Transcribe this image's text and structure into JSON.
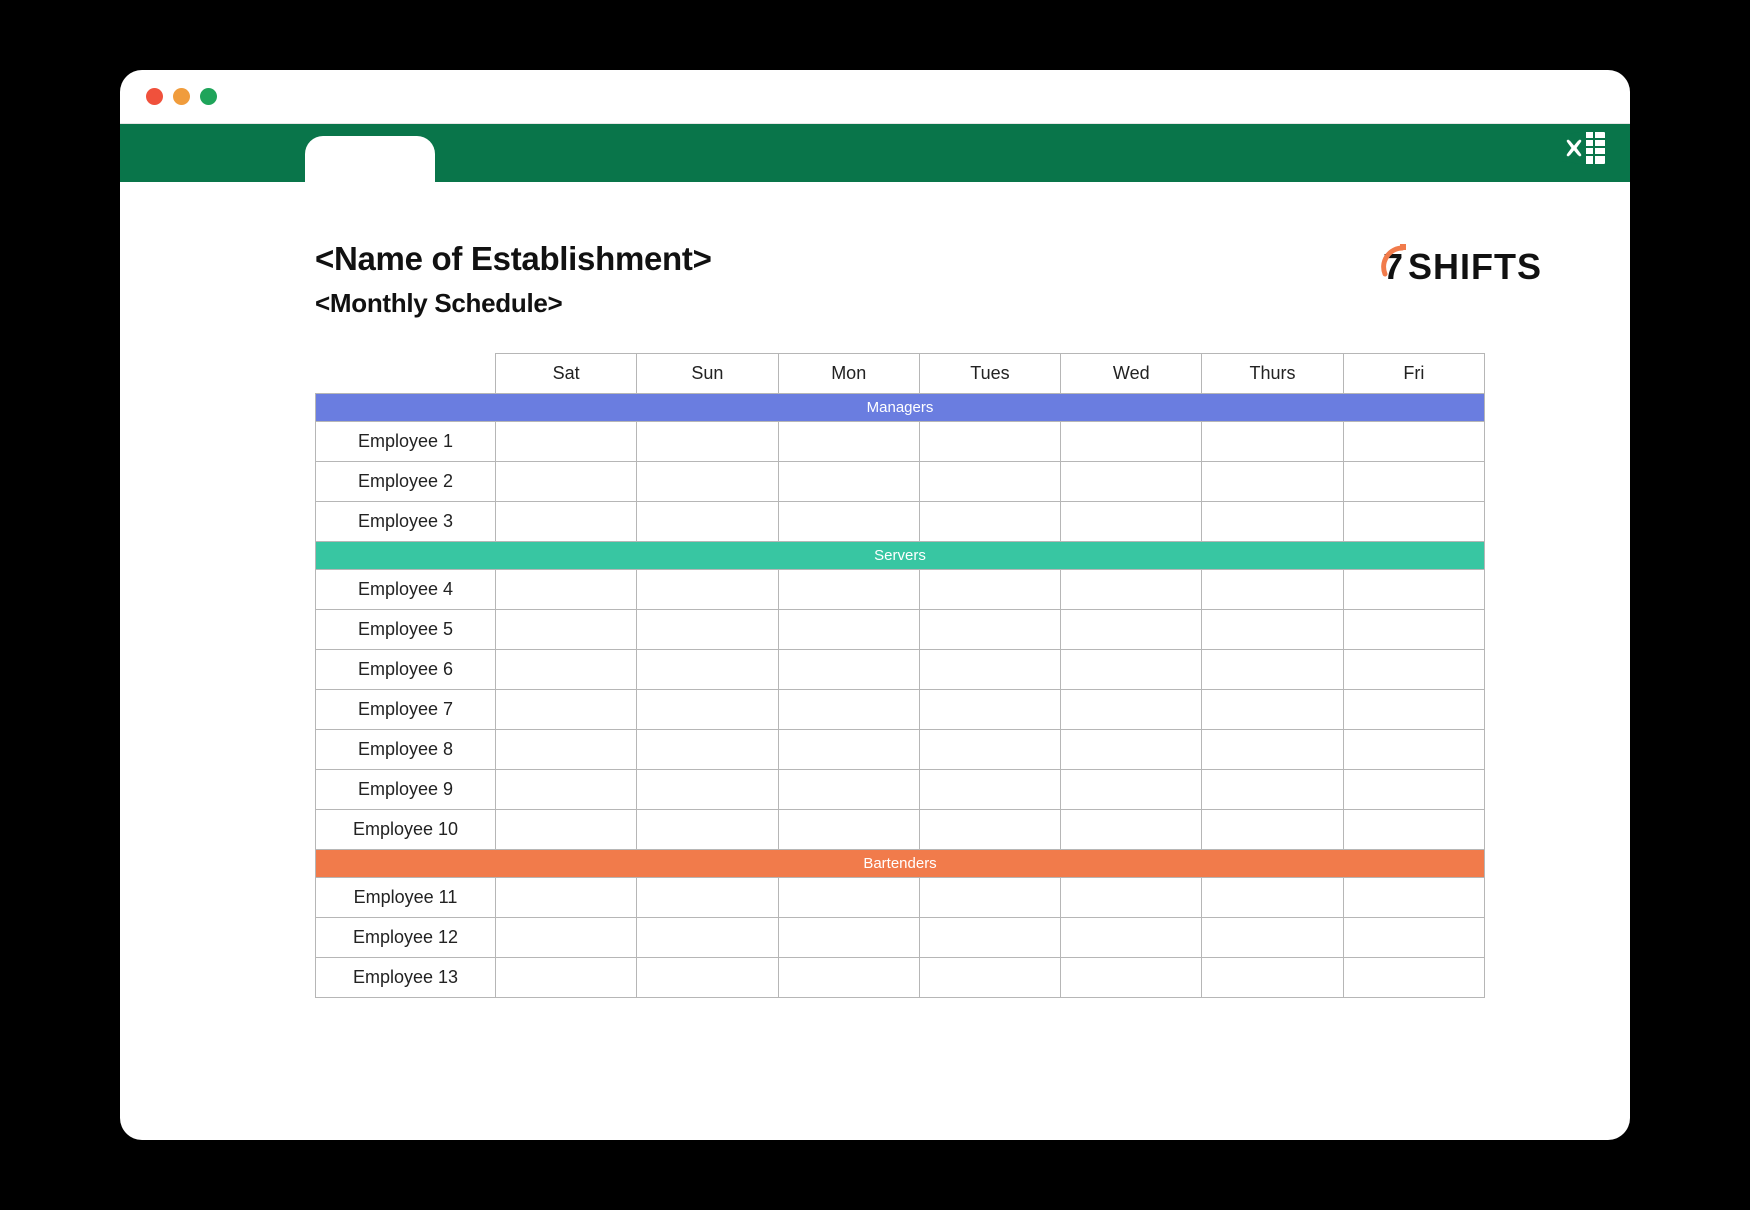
{
  "titlebar": {
    "dots": [
      "red",
      "yellow",
      "green"
    ]
  },
  "header": {
    "title": "<Name of Establishment>",
    "subtitle": "<Monthly Schedule>"
  },
  "brand": {
    "digit": "7",
    "word": "SHIFTS",
    "accent": "#f17b4b"
  },
  "days": [
    "Sat",
    "Sun",
    "Mon",
    "Tues",
    "Wed",
    "Thurs",
    "Fri"
  ],
  "sections": [
    {
      "name": "Managers",
      "class": "managers",
      "employees": [
        "Employee 1",
        "Employee 2",
        "Employee 3"
      ]
    },
    {
      "name": "Servers",
      "class": "servers",
      "employees": [
        "Employee 4",
        "Employee 5",
        "Employee 6",
        "Employee 7",
        "Employee 8",
        "Employee 9",
        "Employee 10"
      ]
    },
    {
      "name": "Bartenders",
      "class": "bartenders",
      "employees": [
        "Employee 11",
        "Employee 12",
        "Employee 13"
      ]
    }
  ],
  "colors": {
    "ribbon": "#09754a",
    "managers": "#6a7de0",
    "servers": "#38c6a2",
    "bartenders": "#f17b4b"
  }
}
